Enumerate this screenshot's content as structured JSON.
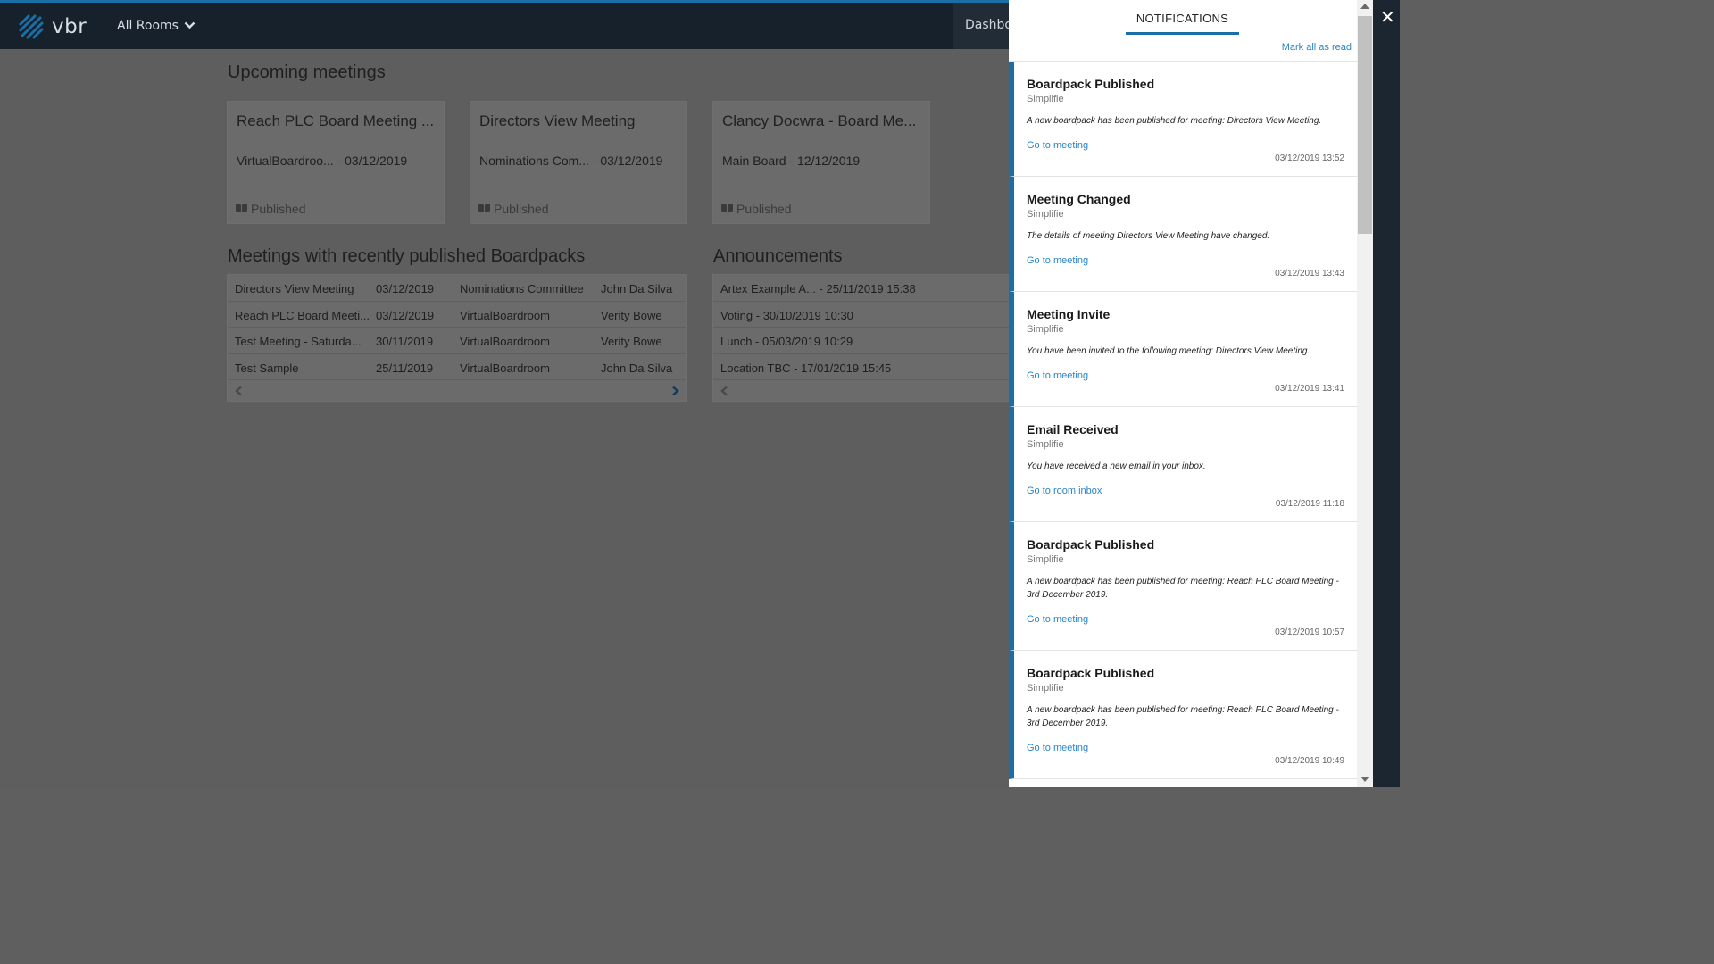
{
  "app": {
    "logo_text": "vbr",
    "rooms_label": "All Rooms",
    "dashboard_tab": "Dashboard"
  },
  "upcoming": {
    "title": "Upcoming meetings",
    "cards": [
      {
        "title": "Reach PLC Board Meeting ...",
        "subtitle": "VirtualBoardroo... - 03/12/2019",
        "status": "Published"
      },
      {
        "title": "Directors View Meeting",
        "subtitle": "Nominations Com... - 03/12/2019",
        "status": "Published"
      },
      {
        "title": "Clancy Docwra - Board Me...",
        "subtitle": "Main Board - 12/12/2019",
        "status": "Published"
      }
    ]
  },
  "boardpacks": {
    "title": "Meetings with recently published Boardpacks",
    "rows": [
      {
        "meeting": "Directors View Meeting",
        "date": "03/12/2019",
        "room": "Nominations Committee",
        "user": "John Da Silva"
      },
      {
        "meeting": "Reach PLC Board Meeti...",
        "date": "03/12/2019",
        "room": "VirtualBoardroom",
        "user": "Verity Bowe"
      },
      {
        "meeting": "Test Meeting - Saturda...",
        "date": "30/11/2019",
        "room": "VirtualBoardroom",
        "user": "Verity Bowe"
      },
      {
        "meeting": "Test Sample",
        "date": "25/11/2019",
        "room": "VirtualBoardroom",
        "user": "John Da Silva"
      }
    ]
  },
  "announcements": {
    "title": "Announcements",
    "rows": [
      "Artex Example A... - 25/11/2019 15:38",
      "Voting - 30/10/2019 10:30",
      "Lunch - 05/03/2019 10:29",
      "Location TBC - 17/01/2019 15:45"
    ]
  },
  "notifications": {
    "title": "NOTIFICATIONS",
    "mark_all": "Mark all as read",
    "items": [
      {
        "title": "Boardpack Published",
        "source": "Simplifie",
        "message": "A new boardpack has been published for meeting: Directors View Meeting.",
        "link": "Go to meeting",
        "time": "03/12/2019 13:52"
      },
      {
        "title": "Meeting Changed",
        "source": "Simplifie",
        "message": "The details of meeting Directors View Meeting have changed.",
        "link": "Go to meeting",
        "time": "03/12/2019 13:43"
      },
      {
        "title": "Meeting Invite",
        "source": "Simplifie",
        "message": "You have been invited to the following meeting: Directors View Meeting.",
        "link": "Go to meeting",
        "time": "03/12/2019 13:41"
      },
      {
        "title": "Email Received",
        "source": "Simplifie",
        "message": "You have received a new email in your inbox.",
        "link": "Go to room inbox",
        "time": "03/12/2019 11:18"
      },
      {
        "title": "Boardpack Published",
        "source": "Simplifie",
        "message": "A new boardpack has been published for meeting: Reach PLC Board Meeting - 3rd December 2019.",
        "link": "Go to meeting",
        "time": "03/12/2019 10:57"
      },
      {
        "title": "Boardpack Published",
        "source": "Simplifie",
        "message": "A new boardpack has been published for meeting: Reach PLC Board Meeting - 3rd December 2019.",
        "link": "Go to meeting",
        "time": "03/12/2019 10:49"
      }
    ]
  },
  "colors": {
    "accent": "#1a6fa6",
    "topbar": "#17212b",
    "link": "#2a84c6",
    "overlay": "#5e5e5e"
  },
  "icons": {
    "logo": "vbr-logo-icon",
    "rooms_dropdown": "chevron-down-icon",
    "status": "book-icon",
    "prev": "chevron-left-icon",
    "next": "chevron-right-icon",
    "close": "close-icon"
  }
}
